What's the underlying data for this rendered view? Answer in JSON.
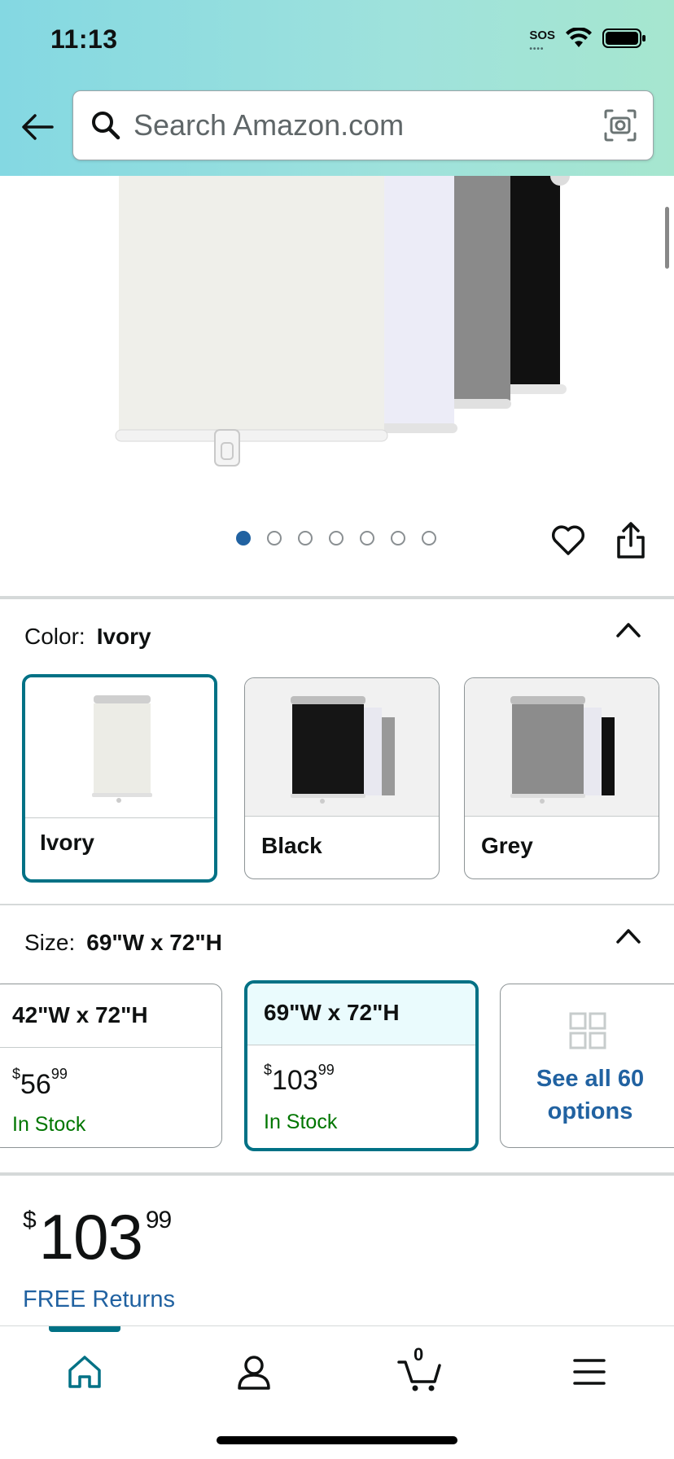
{
  "status_bar": {
    "time": "11:13",
    "sos": "SOS"
  },
  "search": {
    "placeholder": "Search Amazon.com"
  },
  "gallery": {
    "dot_count": 7,
    "active_index": 0
  },
  "color": {
    "label": "Color:",
    "selected": "Ivory",
    "options": [
      {
        "label": "Ivory",
        "selected": true
      },
      {
        "label": "Black",
        "selected": false
      },
      {
        "label": "Grey",
        "selected": false
      }
    ]
  },
  "size": {
    "label": "Size:",
    "selected": "69\"W x 72\"H",
    "options": [
      {
        "name": "42\"W x 72\"H",
        "price_whole": "56",
        "price_cents": "99",
        "currency": "$",
        "stock": "In Stock",
        "selected": false
      },
      {
        "name": "69\"W x 72\"H",
        "price_whole": "103",
        "price_cents": "99",
        "currency": "$",
        "stock": "In Stock",
        "selected": true
      }
    ],
    "see_all": "See all 60 options"
  },
  "price": {
    "currency": "$",
    "whole": "103",
    "cents": "99"
  },
  "returns": "FREE Returns",
  "tabbar": {
    "cart_count": "0",
    "active": "home"
  },
  "colors": {
    "accent": "#007185",
    "link": "#2162a1",
    "stock": "#007600"
  }
}
